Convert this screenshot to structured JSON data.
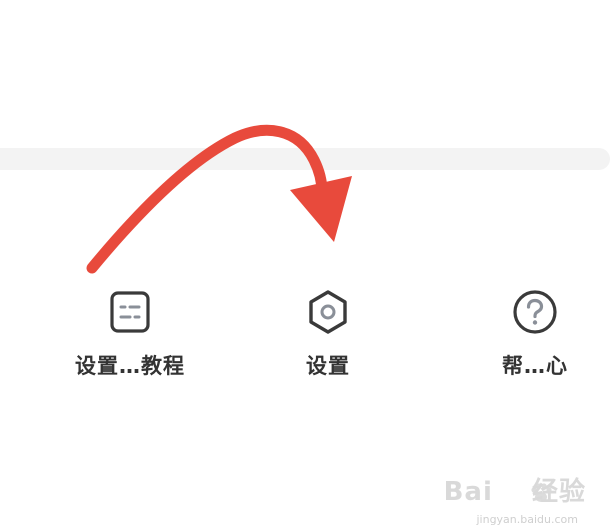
{
  "menu": {
    "items": [
      {
        "label": "设置…教程",
        "icon": "tutorial-card-icon"
      },
      {
        "label": "设置",
        "icon": "hexagon-settings-icon"
      },
      {
        "label": "帮…心",
        "icon": "question-circle-icon"
      }
    ]
  },
  "annotation": {
    "arrow_color": "#e84a3c",
    "arrow_points_to": "settings"
  },
  "watermark": {
    "brand": "Baidu经验",
    "domain": "jingyan.baidu.com"
  },
  "colors": {
    "icon_stroke": "#3a3a3a",
    "label_text": "#333333",
    "divider": "#f3f3f3"
  }
}
